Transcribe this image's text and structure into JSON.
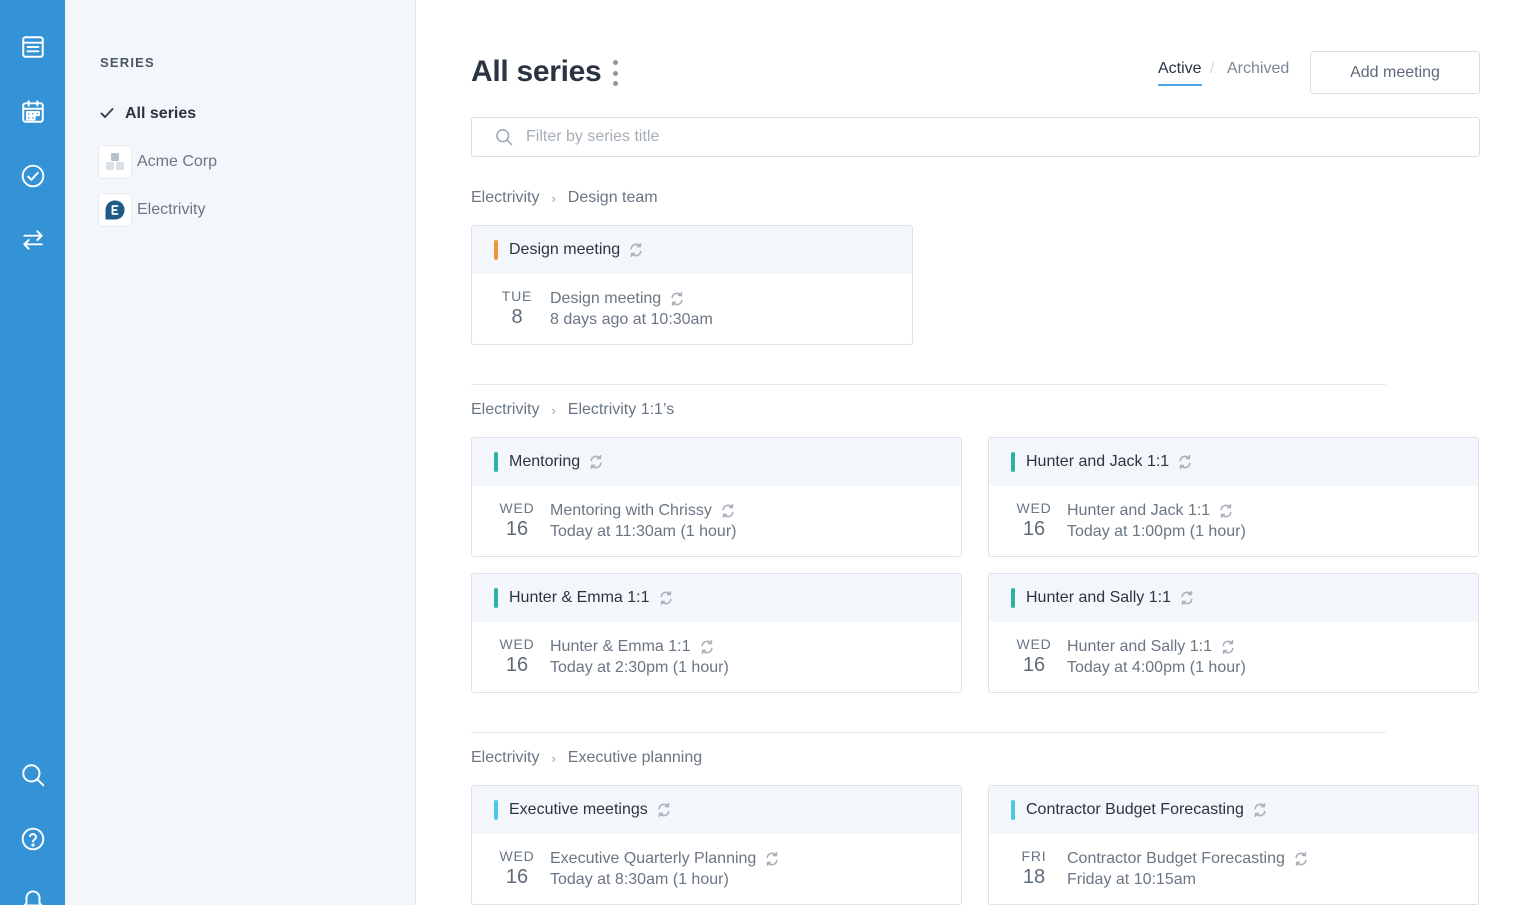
{
  "sidebar": {
    "heading": "SERIES",
    "items": [
      {
        "label": "All series"
      },
      {
        "label": "Acme Corp"
      },
      {
        "label": "Electrivity"
      }
    ]
  },
  "header": {
    "title": "All series",
    "toggle_active": "Active",
    "toggle_separator": "/",
    "toggle_archived": "Archived",
    "add_button": "Add meeting"
  },
  "filter": {
    "placeholder": "Filter by series title"
  },
  "groups": [
    {
      "org": "Electrivity",
      "team": "Design team",
      "cards": [
        {
          "title": "Design meeting",
          "accent": "#f0943a",
          "dow": "TUE",
          "day": "8",
          "meeting": "Design meeting",
          "when": "8 days ago at 10:30am"
        }
      ]
    },
    {
      "org": "Electrivity",
      "team": "Electrivity 1:1’s",
      "cards": [
        {
          "title": "Mentoring",
          "accent": "#2bb3a6",
          "dow": "WED",
          "day": "16",
          "meeting": "Mentoring with Chrissy",
          "when": "Today at 11:30am (1 hour)"
        },
        {
          "title": "Hunter and Jack 1:1",
          "accent": "#2bb3a6",
          "dow": "WED",
          "day": "16",
          "meeting": "Hunter and Jack 1:1",
          "when": "Today at 1:00pm (1 hour)"
        },
        {
          "title": "Hunter & Emma 1:1",
          "accent": "#2bb3a6",
          "dow": "WED",
          "day": "16",
          "meeting": "Hunter & Emma 1:1",
          "when": "Today at 2:30pm (1 hour)"
        },
        {
          "title": "Hunter and Sally 1:1",
          "accent": "#2bb3a6",
          "dow": "WED",
          "day": "16",
          "meeting": "Hunter and Sally 1:1",
          "when": "Today at 4:00pm (1 hour)"
        }
      ]
    },
    {
      "org": "Electrivity",
      "team": "Executive planning",
      "cards": [
        {
          "title": "Executive meetings",
          "accent": "#4cc8e4",
          "dow": "WED",
          "day": "16",
          "meeting": "Executive Quarterly Planning",
          "when": "Today at 8:30am (1 hour)"
        },
        {
          "title": "Contractor Budget Forecasting",
          "accent": "#4cc8e4",
          "dow": "FRI",
          "day": "18",
          "meeting": "Contractor Budget Forecasting",
          "when": "Friday at 10:15am"
        }
      ]
    }
  ],
  "icons": {
    "rail": [
      "list-icon",
      "calendar-icon",
      "check-circle-icon",
      "swap-arrows-icon",
      "search-icon",
      "help-icon",
      "bell-icon"
    ],
    "recurring": "recurring-icon"
  },
  "colors": {
    "rail": "#3393d6",
    "accent_orange": "#f0943a",
    "accent_teal": "#2bb3a6",
    "accent_cyan": "#4cc8e4"
  }
}
